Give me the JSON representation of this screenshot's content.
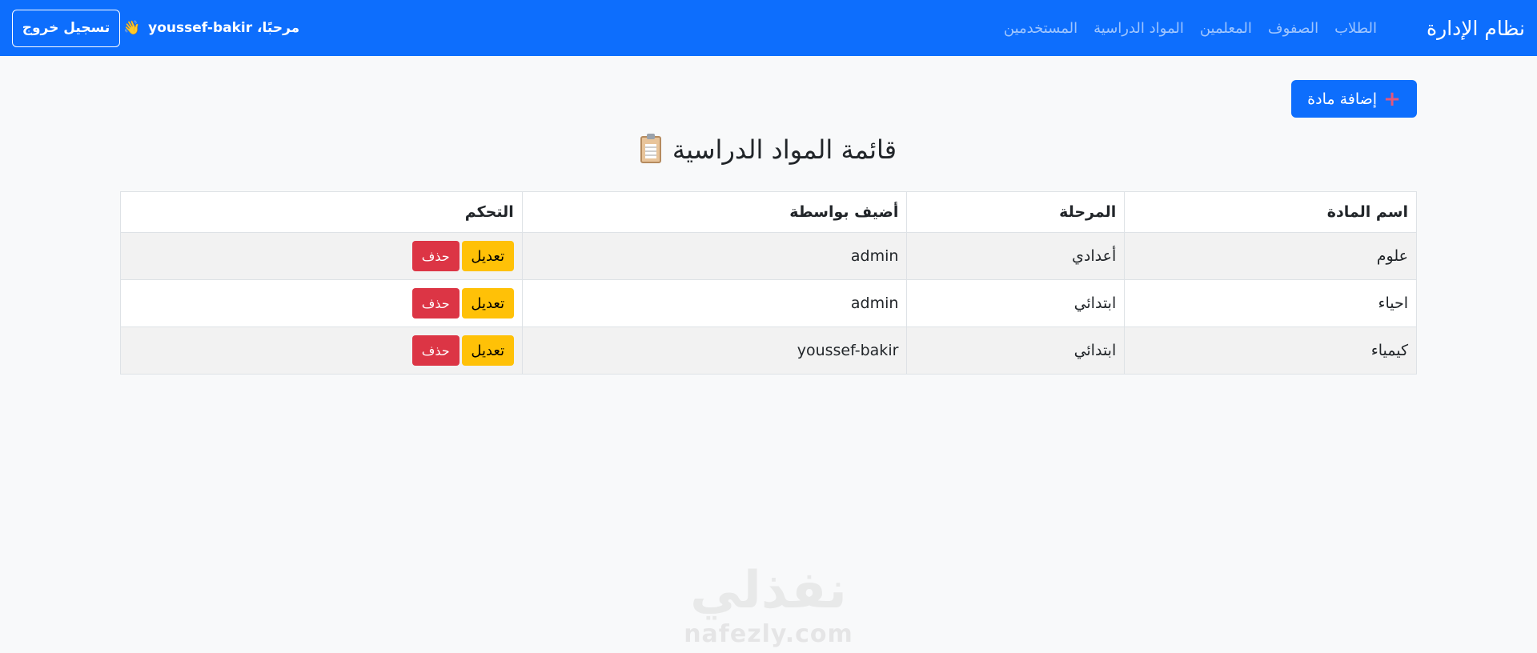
{
  "navbar": {
    "brand": "نظام الإدارة",
    "links": [
      "الطلاب",
      "الصفوف",
      "المعلمين",
      "المواد الدراسية",
      "المستخدمين"
    ],
    "welcome": "مرحبًا، youssef-bakir",
    "wave_icon": "👋",
    "logout_label": "تسجيل خروج"
  },
  "toolbar": {
    "add_label": "إضافة مادة",
    "add_icon": "plus-icon"
  },
  "page": {
    "title": "قائمة المواد الدراسية",
    "title_icon": "clipboard-icon"
  },
  "table": {
    "headers": [
      "اسم المادة",
      "المرحلة",
      "أضيف بواسطة",
      "التحكم"
    ],
    "rows": [
      {
        "name": "علوم",
        "stage": "أعدادي",
        "added_by": "admin",
        "edit": "تعديل",
        "delete": "حذف"
      },
      {
        "name": "احياء",
        "stage": "ابتدائي",
        "added_by": "admin",
        "edit": "تعديل",
        "delete": "حذف"
      },
      {
        "name": "كيمياء",
        "stage": "ابتدائي",
        "added_by": "youssef-bakir",
        "edit": "تعديل",
        "delete": "حذف"
      }
    ]
  },
  "watermark": {
    "arabic": "نفذلي",
    "latin": "nafezly.com"
  },
  "colors": {
    "primary": "#0d6efd",
    "warning": "#ffc107",
    "danger": "#dc3545",
    "background": "#f8f9fa"
  }
}
